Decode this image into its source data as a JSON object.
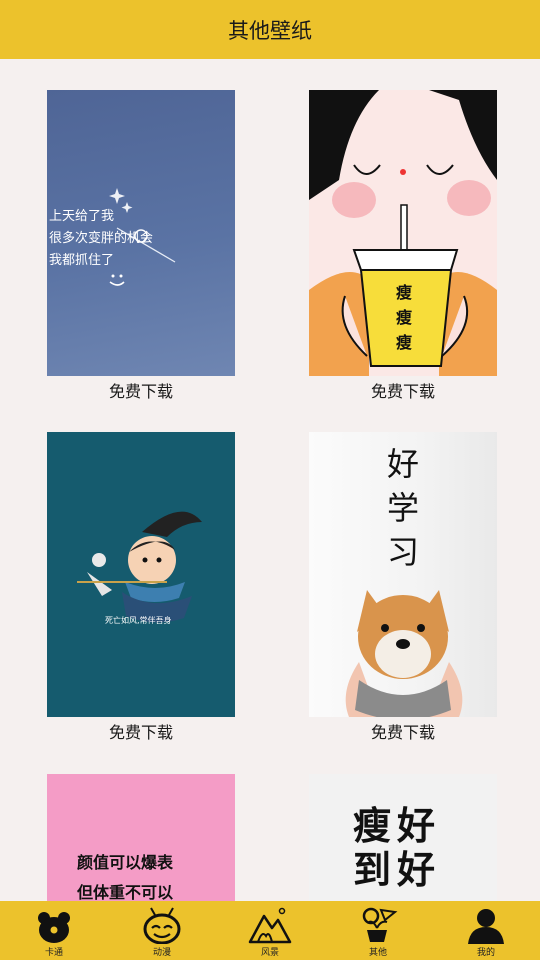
{
  "header": {
    "title": "其他壁纸"
  },
  "cards": [
    {
      "caption": "免费下载",
      "text_lines": [
        "上天给了我",
        "很多次变胖的机会",
        "我都抓住了"
      ]
    },
    {
      "caption": "免费下载",
      "cup_text": [
        "瘦",
        "瘦",
        "瘦"
      ]
    },
    {
      "caption": "免费下载",
      "text": "死亡如风,常伴吾身"
    },
    {
      "caption": "免费下载",
      "text_lines": [
        "好",
        "学",
        "习"
      ]
    },
    {
      "text_lines": [
        "颜值可以爆表",
        "但体重不可以"
      ]
    },
    {
      "text_lines": [
        "瘦好",
        "到好"
      ]
    }
  ],
  "nav": [
    {
      "label": "卡通",
      "icon": "bear-icon"
    },
    {
      "label": "动漫",
      "icon": "cartoon-face-icon"
    },
    {
      "label": "风景",
      "icon": "mountain-icon"
    },
    {
      "label": "其他",
      "icon": "plant-pot-icon"
    },
    {
      "label": "我的",
      "icon": "user-icon"
    }
  ],
  "colors": {
    "accent": "#ecc22c",
    "background": "#f5f0ef"
  }
}
